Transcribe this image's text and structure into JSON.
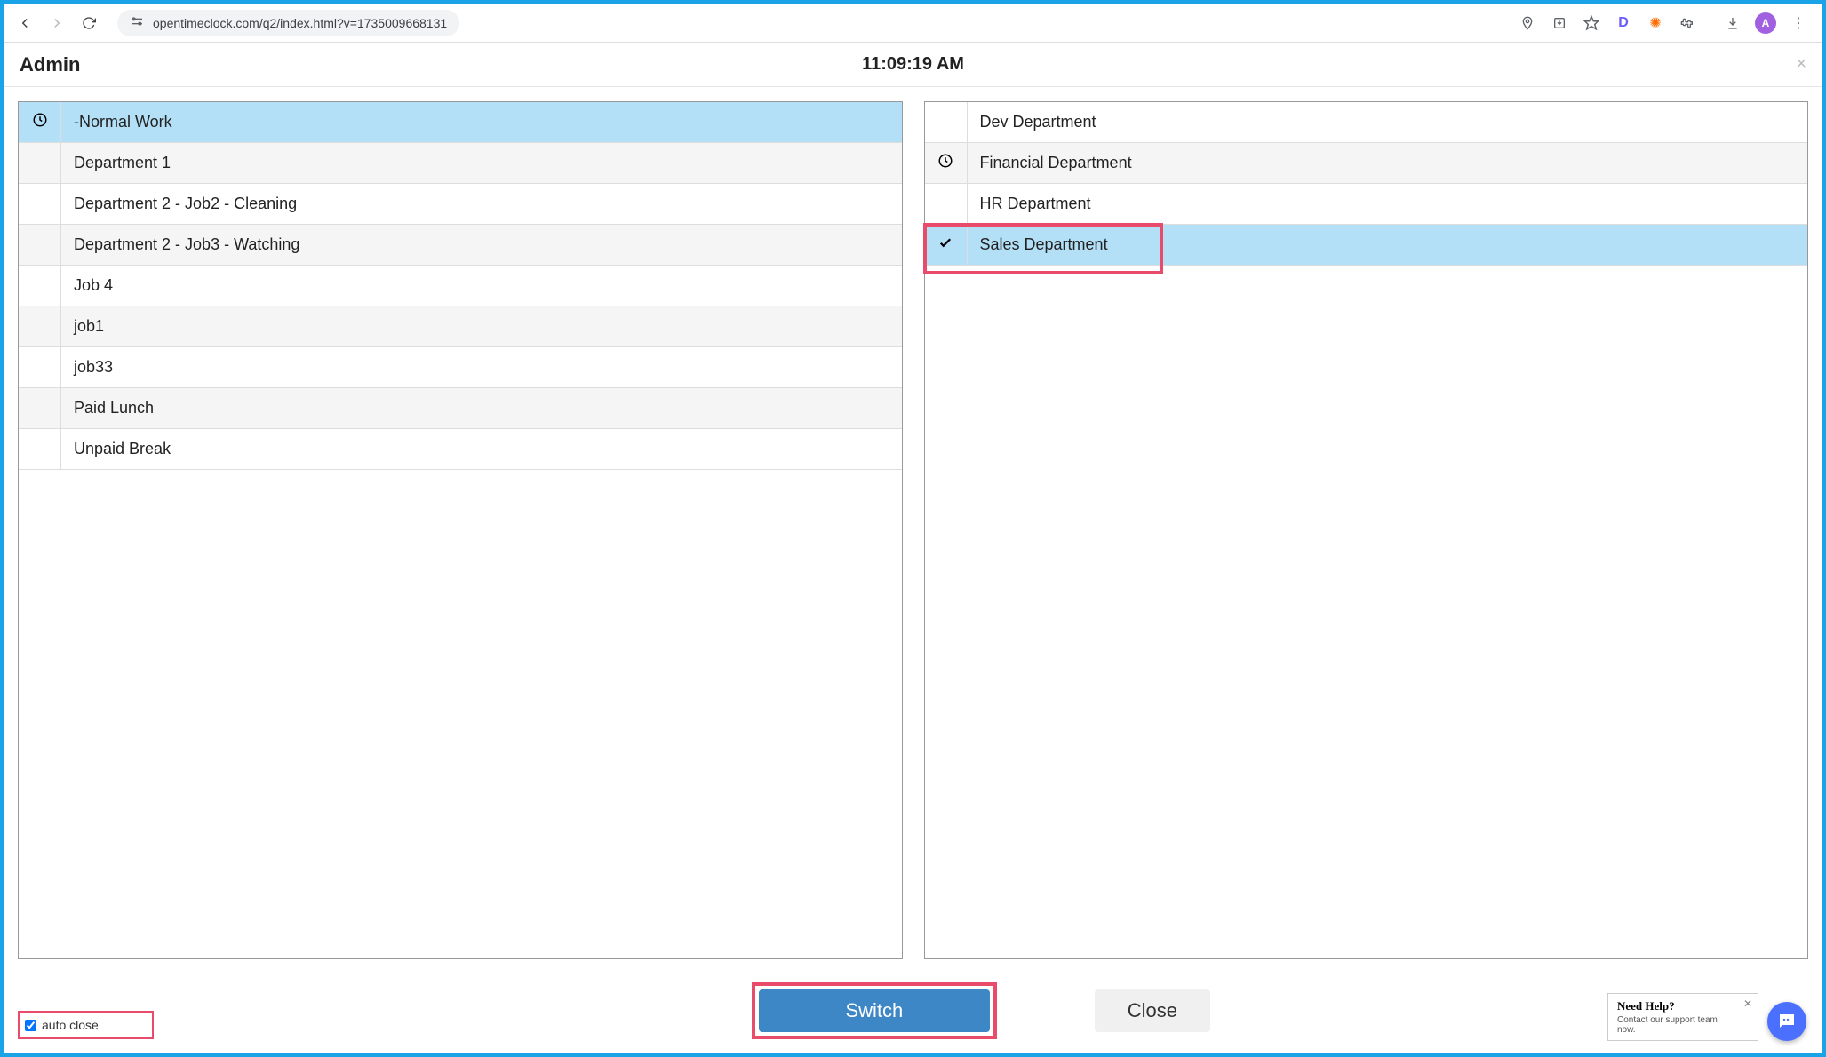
{
  "browser": {
    "url": "opentimeclock.com/q2/index.html?v=1735009668131",
    "avatar_letter": "A"
  },
  "modal": {
    "title": "Admin",
    "time": "11:09:19 AM"
  },
  "left_panel": {
    "rows": [
      {
        "label": "-Normal Work",
        "icon": "clock",
        "selected": true
      },
      {
        "label": "Department 1",
        "icon": "",
        "selected": false
      },
      {
        "label": "Department 2 - Job2 - Cleaning",
        "icon": "",
        "selected": false
      },
      {
        "label": "Department 2 - Job3 - Watching",
        "icon": "",
        "selected": false
      },
      {
        "label": "Job 4",
        "icon": "",
        "selected": false
      },
      {
        "label": "job1",
        "icon": "",
        "selected": false
      },
      {
        "label": "job33",
        "icon": "",
        "selected": false
      },
      {
        "label": "Paid Lunch",
        "icon": "",
        "selected": false
      },
      {
        "label": "Unpaid Break",
        "icon": "",
        "selected": false
      }
    ]
  },
  "right_panel": {
    "rows": [
      {
        "label": "Dev Department",
        "icon": "",
        "selected": false
      },
      {
        "label": "Financial Department",
        "icon": "clock",
        "selected": false
      },
      {
        "label": "HR Department",
        "icon": "",
        "selected": false
      },
      {
        "label": "Sales Department",
        "icon": "check",
        "selected": true,
        "highlight": true
      }
    ]
  },
  "footer": {
    "auto_close_label": "auto close",
    "auto_close_checked": true,
    "switch_label": "Switch",
    "close_label": "Close"
  },
  "help": {
    "title": "Need Help?",
    "subtitle": "Contact our support team now."
  }
}
